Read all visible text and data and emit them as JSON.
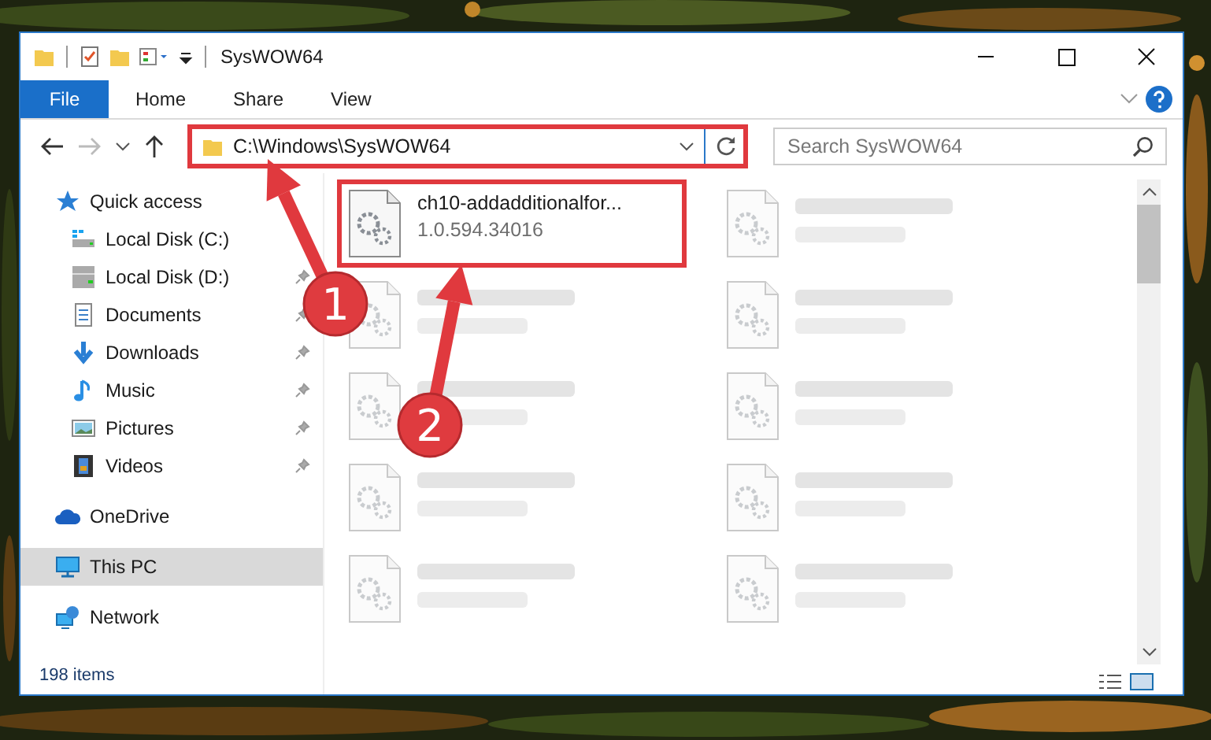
{
  "window": {
    "title": "SysWOW64"
  },
  "ribbon_tabs": [
    {
      "label": "File",
      "selected": true
    },
    {
      "label": "Home",
      "selected": false
    },
    {
      "label": "Share",
      "selected": false
    },
    {
      "label": "View",
      "selected": false
    }
  ],
  "address": {
    "value": "C:\\Windows\\SysWOW64",
    "highlighted": true
  },
  "search": {
    "placeholder": "Search SysWOW64"
  },
  "sidebar": {
    "items": [
      {
        "label": "Quick access",
        "kind": "star",
        "selected": false,
        "children": [
          {
            "label": "Local Disk (C:)",
            "kind": "system-drive",
            "selected": false,
            "pinned": false
          },
          {
            "label": "Local Disk (D:)",
            "kind": "drive",
            "selected": false,
            "pinned": true
          },
          {
            "label": "Documents",
            "kind": "document",
            "selected": false,
            "pinned": true
          },
          {
            "label": "Downloads",
            "kind": "download",
            "selected": false,
            "pinned": true
          },
          {
            "label": "Music",
            "kind": "music",
            "selected": false,
            "pinned": true
          },
          {
            "label": "Pictures",
            "kind": "pictures",
            "selected": false,
            "pinned": true
          },
          {
            "label": "Videos",
            "kind": "videos",
            "selected": false,
            "pinned": true
          }
        ]
      },
      {
        "label": "OneDrive",
        "kind": "cloud",
        "selected": false
      },
      {
        "label": "This PC",
        "kind": "computer",
        "selected": true
      },
      {
        "label": "Network",
        "kind": "network",
        "selected": false
      }
    ]
  },
  "files": [
    {
      "kind": "file",
      "name": "ch10-addadditionalfor...",
      "detail": "1.0.594.34016",
      "highlighted": true
    },
    {
      "kind": "blurred",
      "highlighted": false
    },
    {
      "kind": "blurred",
      "highlighted": false
    },
    {
      "kind": "blurred",
      "highlighted": false
    },
    {
      "kind": "blurred",
      "highlighted": false
    },
    {
      "kind": "blurred",
      "highlighted": false
    },
    {
      "kind": "blurred",
      "highlighted": false
    },
    {
      "kind": "blurred",
      "highlighted": false
    },
    {
      "kind": "blurred",
      "highlighted": false
    },
    {
      "kind": "blurred",
      "highlighted": false
    }
  ],
  "status_bar": {
    "count": "198 items"
  },
  "annotations": [
    {
      "number": "1"
    },
    {
      "number": "2"
    }
  ]
}
